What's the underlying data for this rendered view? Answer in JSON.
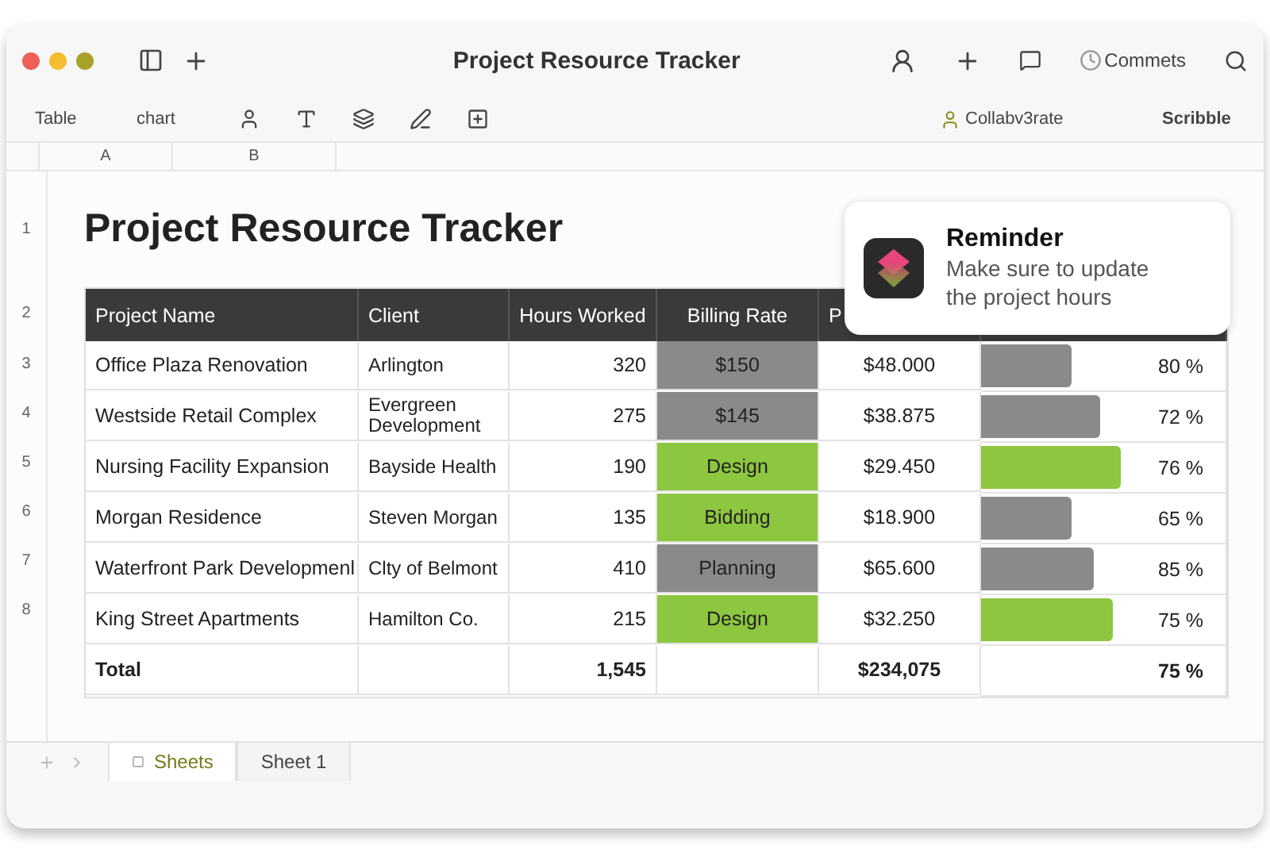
{
  "window": {
    "title": "Project Resource Tracker"
  },
  "toolbar_right": {
    "comments": "Commets"
  },
  "toolbar": {
    "items": [
      {
        "kind": "text",
        "label": "Table"
      },
      {
        "kind": "text",
        "label": "chart"
      },
      {
        "kind": "icon"
      },
      {
        "kind": "icon"
      },
      {
        "kind": "icon"
      },
      {
        "kind": "icon"
      },
      {
        "kind": "icon"
      }
    ],
    "collaborate": "Collabv3rate",
    "scribble": "Scribble"
  },
  "column_headers": [
    "A",
    "B"
  ],
  "row_numbers": [
    "1",
    "2",
    "3",
    "4",
    "5",
    "6",
    "7",
    "8"
  ],
  "sheet_title": "Project Resource Tracker",
  "table": {
    "columns": [
      "Project Name",
      "Client",
      "Hours Worked",
      "Billing Rate",
      "P"
    ],
    "rows": [
      {
        "project": "Office Plaza Renovation",
        "client": "Arlington",
        "hours": "320",
        "rate": "$150",
        "rate_highlighted": false,
        "cost": "$48.000",
        "bar_highlighted": false,
        "level": 0.37,
        "percent": "80 %"
      },
      {
        "project": "Westside Retail Complex",
        "client": "Evergreen Development",
        "hours": "275",
        "rate": "$145",
        "rate_highlighted": false,
        "cost": "$38.875",
        "bar_highlighted": false,
        "level": 0.49,
        "percent": "72 %"
      },
      {
        "project": "Nursing Facility Expansion",
        "client": "Bayside Health",
        "hours": "190",
        "rate": "Design",
        "rate_highlighted": true,
        "cost": "$29.450",
        "bar_highlighted": true,
        "level": 0.57,
        "percent": "76 %"
      },
      {
        "project": "Morgan Residence",
        "client": "Steven Morgan",
        "hours": "135",
        "rate": "Bidding",
        "rate_highlighted": true,
        "cost": "$18.900",
        "bar_highlighted": false,
        "level": 0.37,
        "percent": "65 %"
      },
      {
        "project": "Waterfront Park Developmenl",
        "client": "Clty of Belmont",
        "hours": "410",
        "rate": "Planning",
        "rate_highlighted": false,
        "cost": "$65.600",
        "bar_highlighted": false,
        "level": 0.46,
        "percent": "85 %"
      },
      {
        "project": "King Street Apartments",
        "client": "Hamilton Co.",
        "hours": "215",
        "rate": "Design",
        "rate_highlighted": true,
        "cost": "$32.250",
        "bar_highlighted": true,
        "level": 0.54,
        "percent": "75 %"
      }
    ],
    "total": {
      "label": "Total",
      "hours": "1,545",
      "cost": "$234,075",
      "percent": "75 %"
    }
  },
  "notification": {
    "title": "Reminder",
    "body": "Make sure to update the project hours"
  },
  "sheet_tabs": [
    {
      "label": "Sheets",
      "selected": true
    },
    {
      "label": "Sheet 1",
      "selected": false
    }
  ]
}
